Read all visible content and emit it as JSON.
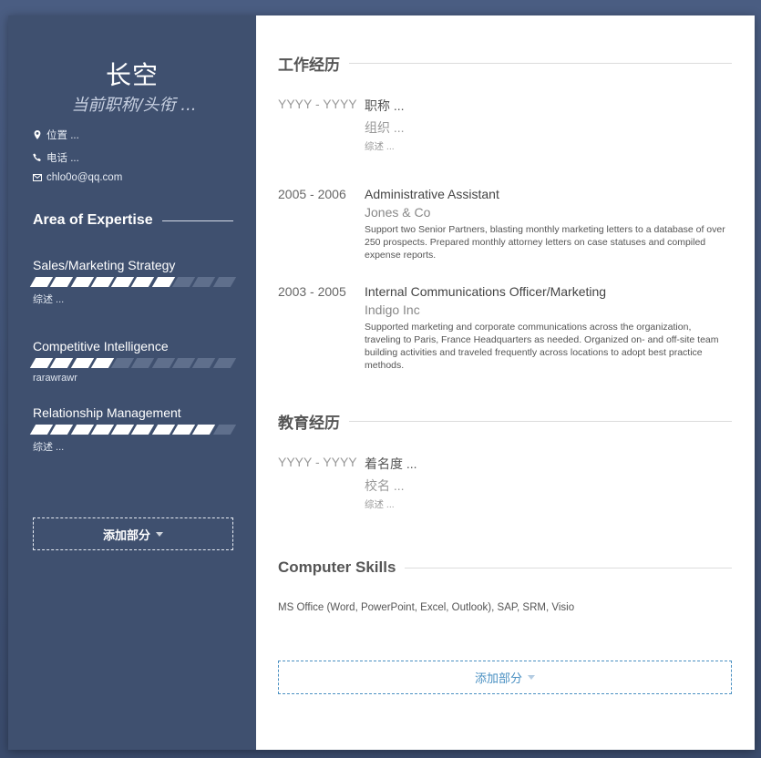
{
  "profile": {
    "name": "长空",
    "subtitle": "当前职称/头衔 ...",
    "location": "位置 ...",
    "phone": "电话 ...",
    "email": "chlo0o@qq.com"
  },
  "expertise": {
    "heading": "Area of Expertise",
    "skills": [
      {
        "name": "Sales/Marketing Strategy",
        "level": 7,
        "max": 10,
        "desc": "综述 ..."
      },
      {
        "name": "Competitive Intelligence",
        "level": 4,
        "max": 10,
        "desc": "rarawrawr"
      },
      {
        "name": "Relationship Management",
        "level": 9,
        "max": 10,
        "desc": "综述 ..."
      }
    ],
    "add_label": "添加部分"
  },
  "work": {
    "heading": "工作经历",
    "entries": [
      {
        "dates": "YYYY - YYYY",
        "title": "职称 ...",
        "org": "组织 ...",
        "desc": "综述 ..."
      },
      {
        "dates": "2005 - 2006",
        "title": "Administrative Assistant",
        "org": "Jones & Co",
        "desc": "Support two Senior Partners, blasting monthly marketing letters to a database of over 250 prospects. Prepared monthly attorney letters on case statuses and compiled expense reports."
      },
      {
        "dates": "2003 - 2005",
        "title": "Internal Communications Officer/Marketing",
        "org": "Indigo Inc",
        "desc": "Supported marketing and corporate communications across the organization, traveling to Paris, France Headquarters as needed. Organized on- and off-site team building activities and traveled frequently across locations to adopt best practice methods."
      }
    ]
  },
  "education": {
    "heading": "教育经历",
    "entries": [
      {
        "dates": "YYYY - YYYY",
        "title": "着名度 ...",
        "org": "校名 ...",
        "desc": "综述 ..."
      }
    ]
  },
  "computer_skills": {
    "heading": "Computer Skills",
    "text": "MS Office (Word, PowerPoint, Excel, Outlook), SAP, SRM, Visio"
  },
  "main_add_label": "添加部分",
  "colors": {
    "sidebar": "#3f506f",
    "accent": "#4a90c2"
  }
}
